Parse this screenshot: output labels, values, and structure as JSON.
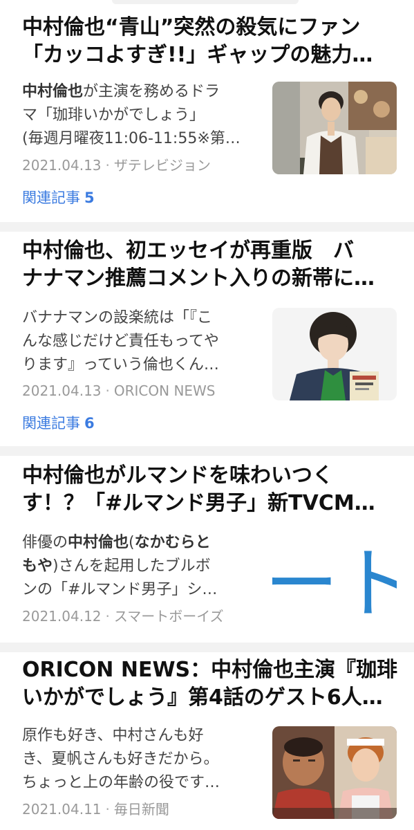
{
  "articles": [
    {
      "title_lines": [
        "中村倫也“青山”突然の殺気にファン",
        "「カッコよすぎ!!」ギャップの魅力…"
      ],
      "snippet_lines": [
        {
          "bold": "中村倫也",
          "rest": "が主演を務めるドラ"
        },
        {
          "bold": "",
          "rest": "マ「珈琲いかがでしょう」"
        },
        {
          "bold": "",
          "rest": "(毎週月曜夜11:06-11:55※第…"
        }
      ],
      "date": "2021.04.13",
      "source": "ザテレビジョン",
      "related_label": "関連記事",
      "related_count": "5",
      "thumb_icon": "photo-actor-apron"
    },
    {
      "title_lines": [
        "中村倫也、初エッセイが再重版　バ",
        "ナナマン推薦コメント入りの新帯に…"
      ],
      "snippet_lines": [
        {
          "bold": "",
          "rest": "バナナマンの設楽統は「『こ"
        },
        {
          "bold": "",
          "rest": "んな感じだけど責任もってや"
        },
        {
          "bold": "",
          "rest": "ります』っていう倫也くん…"
        }
      ],
      "date": "2021.04.13",
      "source": "ORICON NEWS",
      "related_label": "関連記事",
      "related_count": "6",
      "thumb_icon": "photo-actor-book"
    },
    {
      "title_lines": [
        "中村倫也がルマンドを味わいつく",
        "す！？「#ルマンド男子」新TVCM…"
      ],
      "snippet_lines": [
        {
          "bold": "",
          "rest": "俳優の",
          "bold2": "中村倫也",
          "rest2": "(",
          "bold3": "なかむらと",
          "rest3": ""
        },
        {
          "bold": "もや",
          "rest": ")さんを起用したブルボ"
        },
        {
          "bold": "",
          "rest": "ンの「#ルマンド男子」シ…"
        }
      ],
      "date": "2021.04.12",
      "source": "スマートボーイズ",
      "thumb_icon": "blue-text-graphic"
    },
    {
      "title_lines": [
        "ORICON NEWS：中村倫也主演『珈琲",
        "いかがでしょう』第4話のゲスト6人…"
      ],
      "snippet_lines": [
        {
          "bold": "",
          "rest": "原作も好き、中村さんも好"
        },
        {
          "bold": "",
          "rest": "き、夏帆さんも好きだから。"
        },
        {
          "bold": "",
          "rest": "ちょっと上の年齢の役です…"
        }
      ],
      "date": "2021.04.11",
      "source": "毎日新聞",
      "thumb_icon": "photo-two-guests"
    }
  ],
  "thumb3_text": "ートァ"
}
